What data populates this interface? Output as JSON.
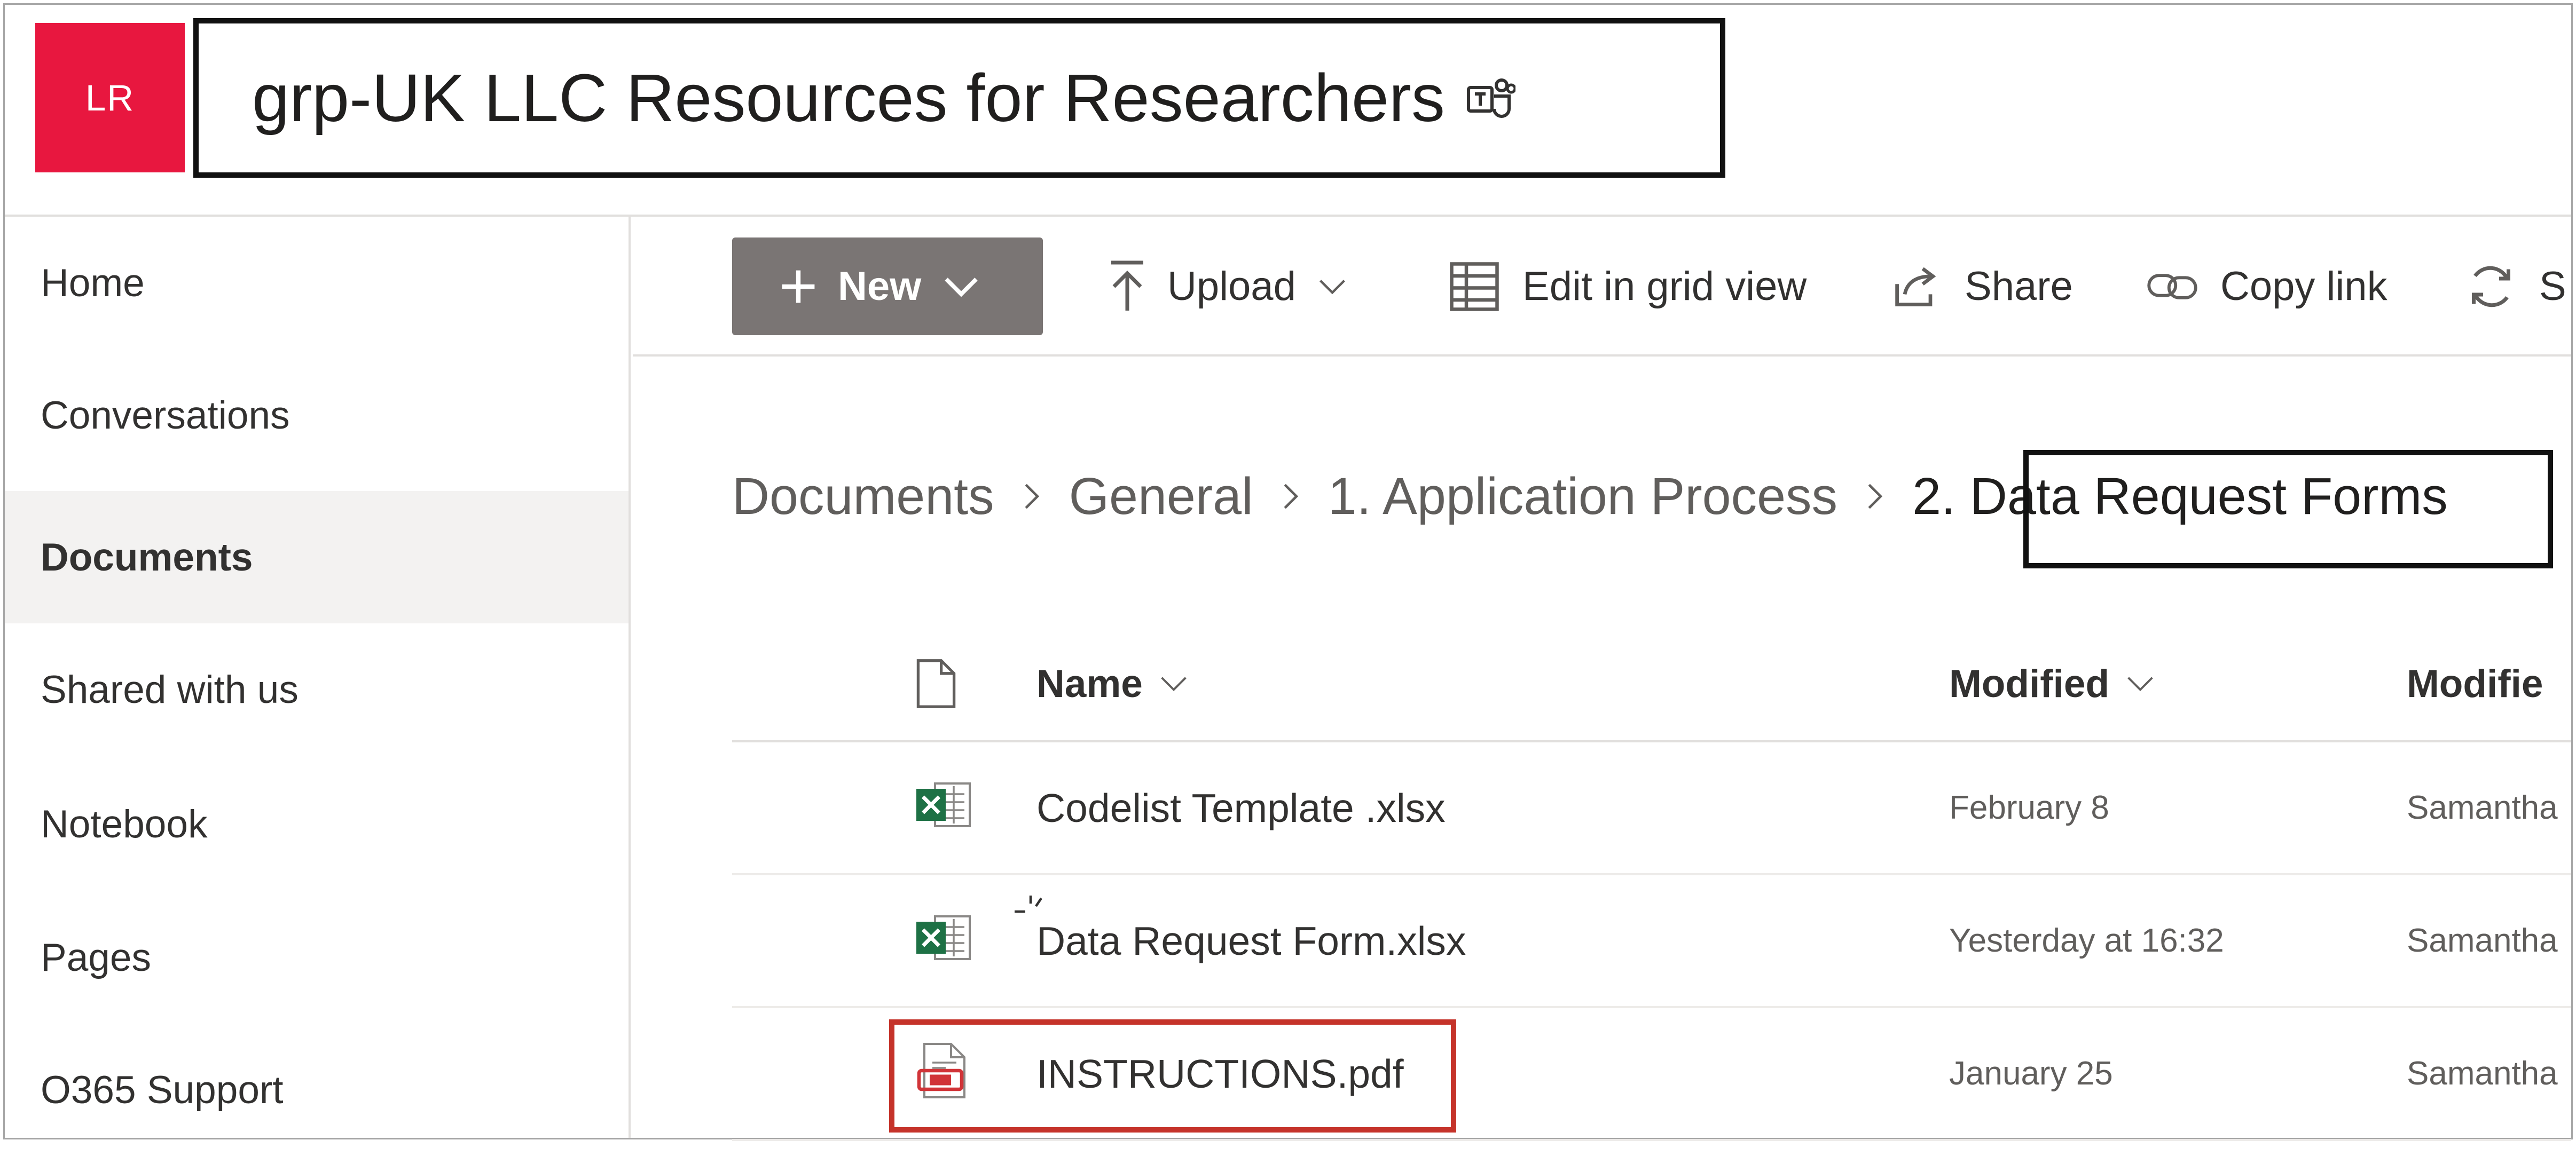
{
  "site": {
    "logo_initials": "LR",
    "title": "grp-UK LLC Resources for Researchers",
    "logo_color": "#e8173f"
  },
  "nav": {
    "items": [
      {
        "label": "Home"
      },
      {
        "label": "Conversations"
      },
      {
        "label": "Documents",
        "selected": true
      },
      {
        "label": "Shared with us"
      },
      {
        "label": "Notebook"
      },
      {
        "label": "Pages"
      },
      {
        "label": "O365 Support"
      }
    ]
  },
  "commandbar": {
    "new_label": "New",
    "upload_label": "Upload",
    "grid_label": "Edit in grid view",
    "share_label": "Share",
    "copylink_label": "Copy link",
    "sync_label": "S"
  },
  "breadcrumb": {
    "items": [
      "Documents",
      "General",
      "1. Application Process"
    ],
    "current": "2. Data Request Forms"
  },
  "list": {
    "columns": {
      "name": "Name",
      "modified": "Modified",
      "modified_by": "Modifie"
    },
    "rows": [
      {
        "name": "Codelist Template .xlsx",
        "modified": "February 8",
        "modified_by": "Samantha",
        "icon": "excel-file-icon"
      },
      {
        "name": "Data Request Form.xlsx",
        "modified": "Yesterday at 16:32",
        "modified_by": "Samantha",
        "icon": "excel-file-icon",
        "new": true
      },
      {
        "name": "INSTRUCTIONS.pdf",
        "modified": "January 25",
        "modified_by": "Samantha",
        "icon": "pdf-file-icon"
      }
    ]
  },
  "colors": {
    "command_new_bg": "#7a7574",
    "highlight_black": "#111111",
    "highlight_red": "#c5332a",
    "excel_green": "#1e7145",
    "pdf_red": "#d13438"
  }
}
